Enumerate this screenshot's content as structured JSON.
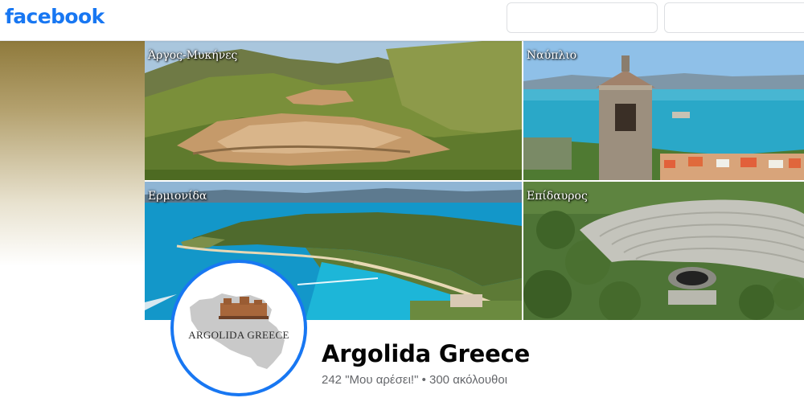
{
  "header": {
    "logo_text": "facebook",
    "email_placeholder": "",
    "password_placeholder": ""
  },
  "cover": {
    "panels": [
      {
        "label": "Άργος-Μυκήνες"
      },
      {
        "label": "Ναύπλιο"
      },
      {
        "label": "Ερμιονίδα"
      },
      {
        "label": "Επίδαυρος"
      }
    ]
  },
  "profile": {
    "avatar_text": "ARGOLIDA GREECE",
    "page_name": "Argolida Greece",
    "likes": "242 \"Μου αρέσει!\"",
    "separator": "•",
    "followers": "300 ακόλουθοι"
  },
  "colors": {
    "brand": "#1877f2",
    "text_primary": "#050505",
    "text_secondary": "#65676b"
  }
}
